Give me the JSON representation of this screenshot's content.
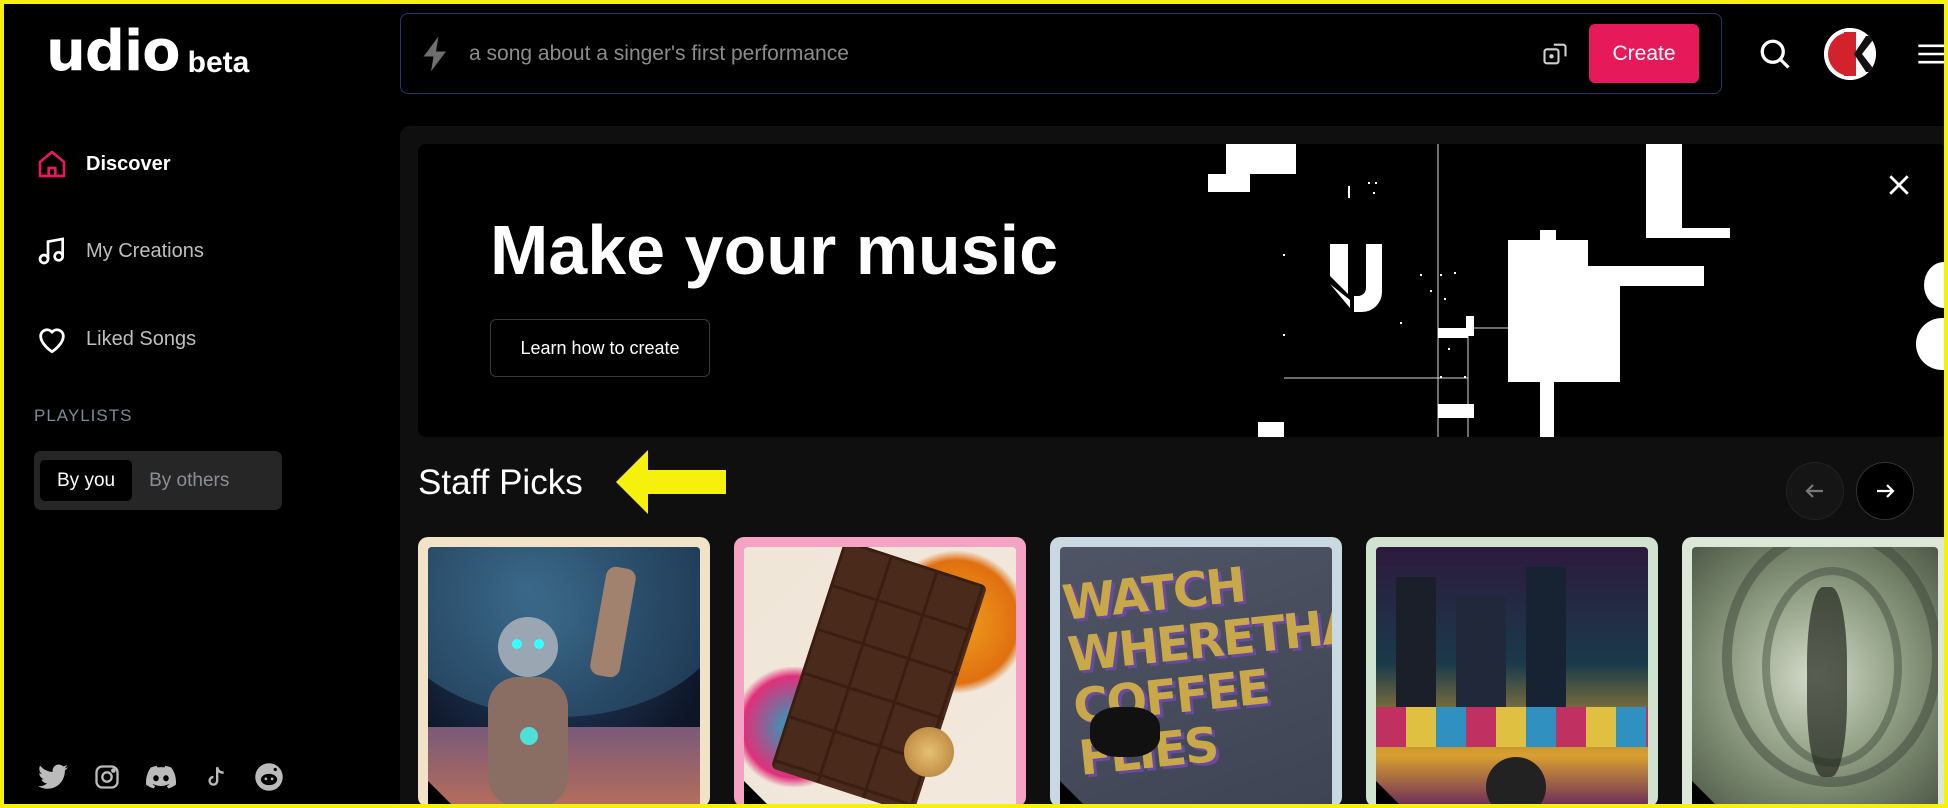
{
  "app": {
    "logo": "udio",
    "badge": "beta"
  },
  "sidebar": {
    "items": [
      {
        "label": "Discover",
        "icon": "home-icon",
        "active": true
      },
      {
        "label": "My Creations",
        "icon": "music-note-icon",
        "active": false
      },
      {
        "label": "Liked Songs",
        "icon": "heart-icon",
        "active": false
      }
    ],
    "playlists_heading": "PLAYLISTS",
    "playlist_tabs": [
      {
        "label": "By you",
        "selected": true
      },
      {
        "label": "By others",
        "selected": false
      }
    ],
    "socials": [
      "twitter-icon",
      "instagram-icon",
      "discord-icon",
      "tiktok-icon",
      "reddit-icon"
    ]
  },
  "topbar": {
    "prompt_placeholder": "a song about a singer's first performance",
    "create_label": "Create",
    "avatar_letter": "K"
  },
  "banner": {
    "title": "Make your music",
    "button": "Learn how to create"
  },
  "staff_picks": {
    "heading": "Staff Picks",
    "cards": [
      {
        "name": "robot-cosmos",
        "frame_color": "#f1e2c8"
      },
      {
        "name": "chocolate-splash",
        "frame_color": "#f5a3c4"
      },
      {
        "name": "watch-where-that-coffee-flies",
        "frame_color": "#c9d9e2"
      },
      {
        "name": "neon-city-mic",
        "frame_color": "#cfe3cf"
      },
      {
        "name": "green-tunnel",
        "frame_color": "#dde7d8"
      }
    ]
  },
  "colors": {
    "accent": "#e6195a",
    "annotation": "#f5f00c"
  }
}
